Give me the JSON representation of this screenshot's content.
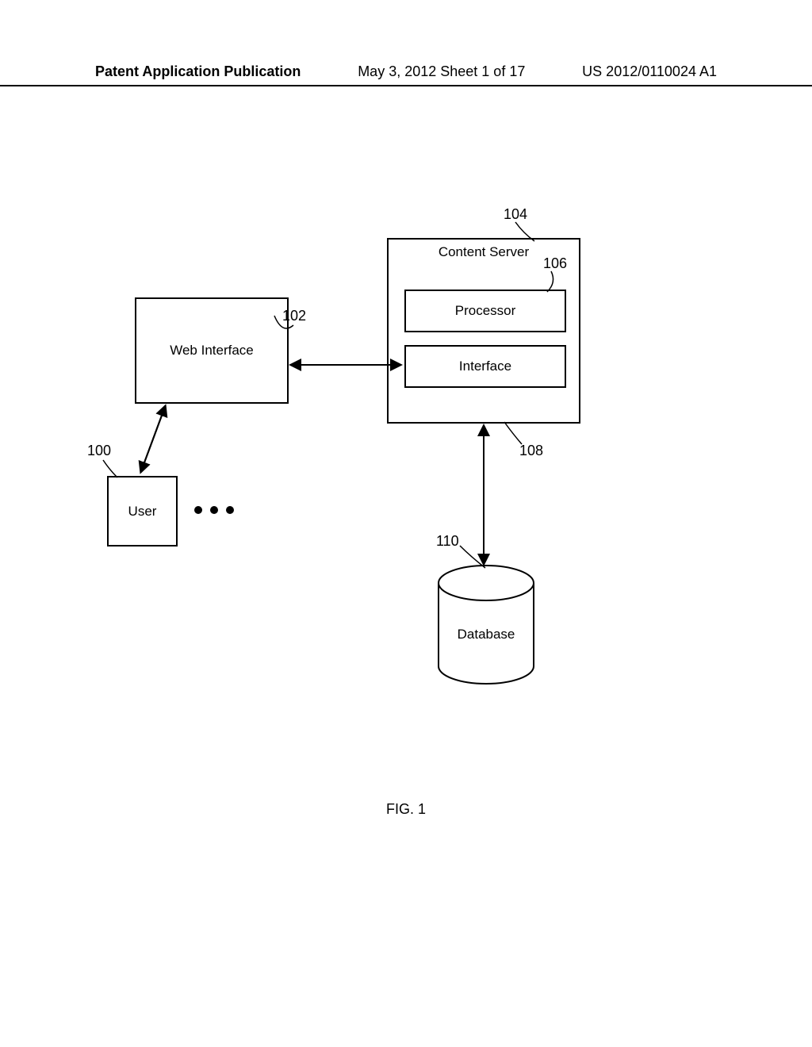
{
  "header": {
    "left": "Patent Application Publication",
    "center": "May 3, 2012  Sheet 1 of 17",
    "right": "US 2012/0110024 A1"
  },
  "figure_label": "FIG. 1",
  "boxes": {
    "web_interface": {
      "label": "Web Interface",
      "ref": "102"
    },
    "user": {
      "label": "User",
      "ref": "100"
    },
    "content_server": {
      "label": "Content Server",
      "ref": "104"
    },
    "processor": {
      "label": "Processor",
      "ref": "106"
    },
    "interface": {
      "label": "Interface",
      "ref": "108"
    },
    "database": {
      "label": "Database",
      "ref": "110"
    }
  }
}
